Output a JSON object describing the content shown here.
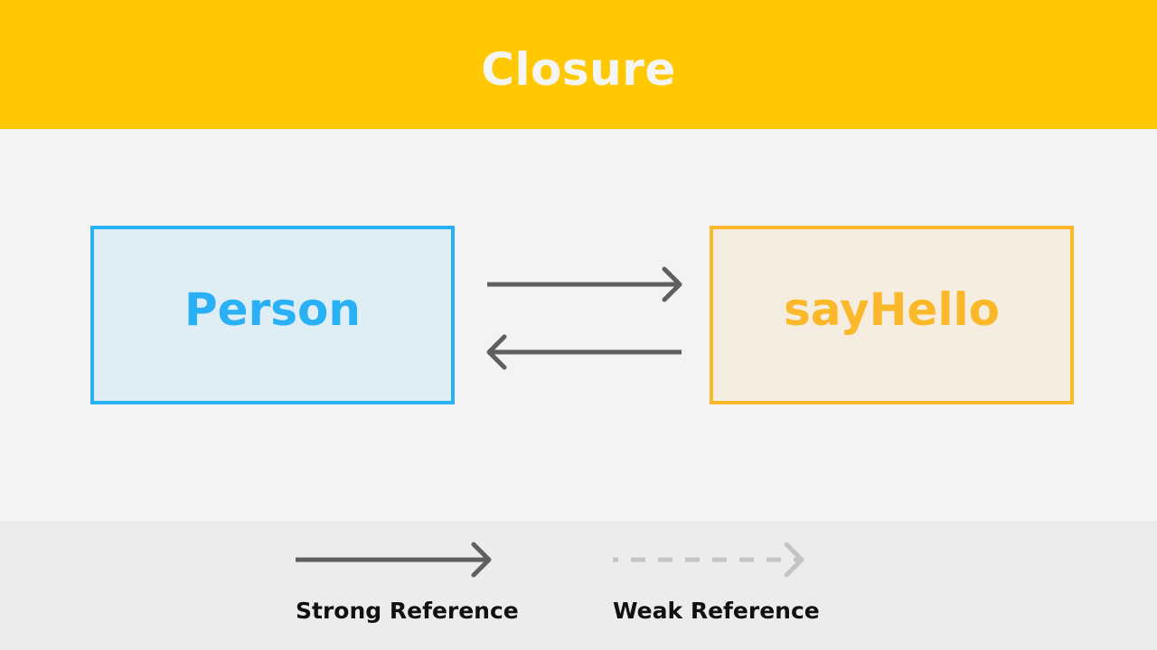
{
  "header": {
    "title": "Closure",
    "background_color": "#ffc800"
  },
  "diagram": {
    "nodes": [
      {
        "id": "person",
        "label": "Person",
        "color": "#29b0f5",
        "fill": "#dfedf4"
      },
      {
        "id": "sayHello",
        "label": "sayHello",
        "color": "#fbb82a",
        "fill": "#f5ede0"
      }
    ],
    "edges": [
      {
        "from": "person",
        "to": "sayHello",
        "type": "strong"
      },
      {
        "from": "sayHello",
        "to": "person",
        "type": "strong"
      }
    ]
  },
  "legend": {
    "items": [
      {
        "type": "strong",
        "label": "Strong Reference",
        "color": "#5f5f5f",
        "style": "solid"
      },
      {
        "type": "weak",
        "label": "Weak Reference",
        "color": "#c4c4c4",
        "style": "dashed"
      }
    ]
  }
}
